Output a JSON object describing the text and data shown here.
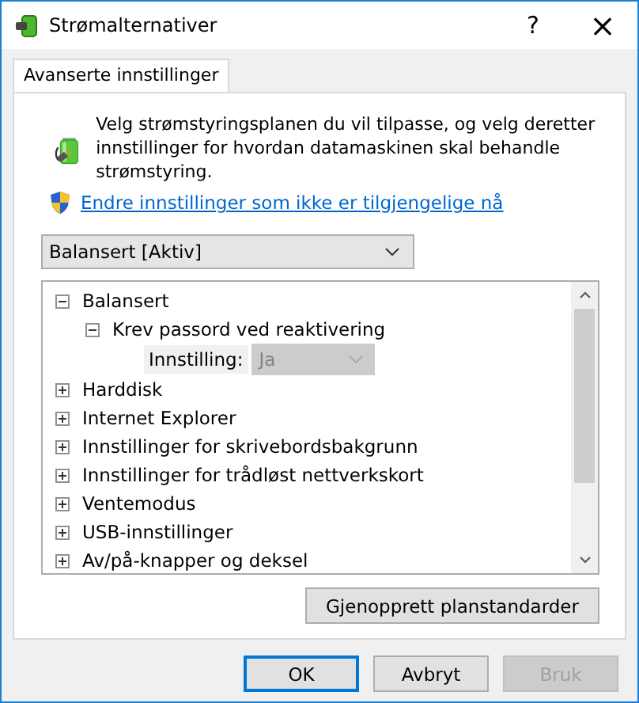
{
  "window": {
    "title": "Strømalternativer",
    "help": "?",
    "close": "×"
  },
  "tabs": [
    {
      "label": "Avanserte innstillinger",
      "selected": true
    }
  ],
  "intro": "Velg strømstyringsplanen du vil tilpasse, og velg deretter innstillinger for hvordan datamaskinen skal behandle strømstyring.",
  "admin_link": "Endre innstillinger som ikke er tilgjengelige nå",
  "plan_dropdown": {
    "value": "Balansert [Aktiv]"
  },
  "tree": [
    {
      "kind": "group",
      "label": "Balansert",
      "expanded": true,
      "children": [
        {
          "kind": "group",
          "label": "Krev passord ved reaktivering",
          "expanded": true,
          "children": [
            {
              "kind": "setting",
              "label": "Innstilling:",
              "value": "Ja",
              "disabled": true
            }
          ]
        }
      ]
    },
    {
      "kind": "group",
      "label": "Harddisk",
      "expanded": false
    },
    {
      "kind": "group",
      "label": "Internet Explorer",
      "expanded": false
    },
    {
      "kind": "group",
      "label": "Innstillinger for skrivebordsbakgrunn",
      "expanded": false
    },
    {
      "kind": "group",
      "label": "Innstillinger for trådløst nettverkskort",
      "expanded": false
    },
    {
      "kind": "group",
      "label": "Ventemodus",
      "expanded": false
    },
    {
      "kind": "group",
      "label": "USB-innstillinger",
      "expanded": false
    },
    {
      "kind": "group",
      "label": "Av/på-knapper og deksel",
      "expanded": false
    }
  ],
  "restore_button": "Gjenopprett planstandarder",
  "buttons": [
    {
      "label": "OK",
      "default": true,
      "disabled": false
    },
    {
      "label": "Avbryt",
      "default": false,
      "disabled": false
    },
    {
      "label": "Bruk",
      "default": false,
      "disabled": true
    }
  ]
}
